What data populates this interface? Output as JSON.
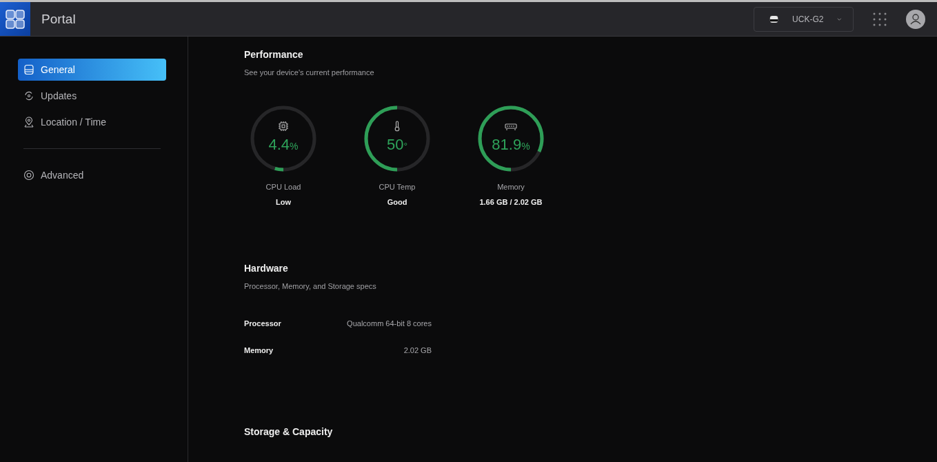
{
  "header": {
    "title": "Portal",
    "device": "UCK-G2"
  },
  "sidebar": {
    "items": [
      {
        "label": "General",
        "kind": "device",
        "selected": true
      },
      {
        "label": "Updates",
        "kind": "refresh",
        "selected": false
      },
      {
        "label": "Location / Time",
        "kind": "pin",
        "selected": false
      }
    ],
    "bottom_items": [
      {
        "label": "Advanced",
        "kind": "gear",
        "selected": false
      }
    ]
  },
  "performance": {
    "title": "Performance",
    "subtitle": "See your device's current performance",
    "gauges": [
      {
        "kind": "chip",
        "value": "4.4",
        "unit": "%",
        "label": "CPU Load",
        "status": "Low",
        "level": 0.044
      },
      {
        "kind": "thermometer",
        "value": "50",
        "unit": "°",
        "label": "CPU Temp",
        "status": "Good",
        "level": 0.5
      },
      {
        "kind": "ram",
        "value": "81.9",
        "unit": "%",
        "label": "Memory",
        "status": "1.66 GB / 2.02 GB",
        "level": 0.819
      }
    ]
  },
  "hardware": {
    "title": "Hardware",
    "subtitle": "Processor, Memory, and Storage specs",
    "specs": [
      {
        "label": "Processor",
        "value": "Qualcomm 64-bit 8 cores"
      },
      {
        "label": "Memory",
        "value": "2.02 GB"
      }
    ]
  },
  "storage": {
    "title": "Storage & Capacity"
  }
}
